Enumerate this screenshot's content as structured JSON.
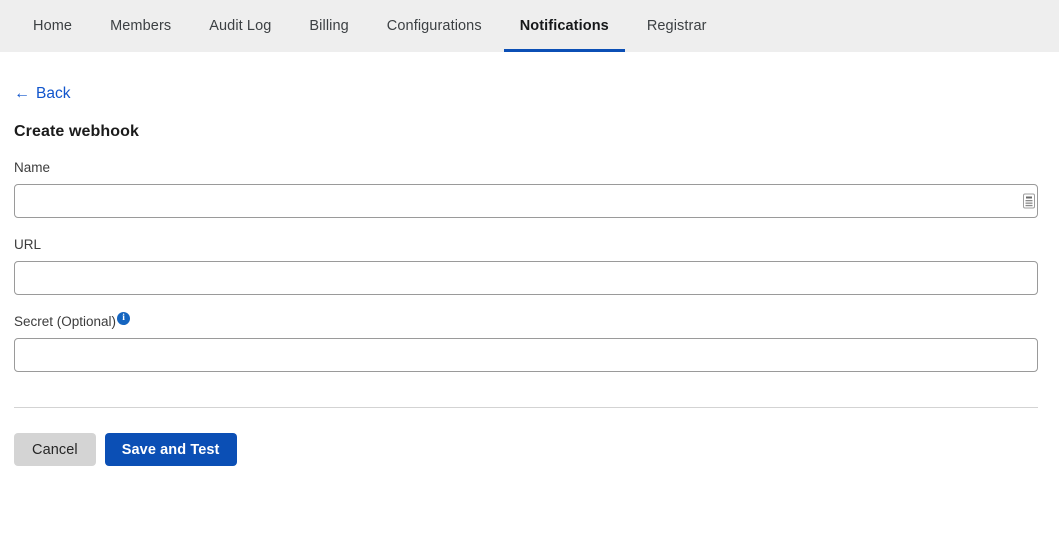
{
  "nav": {
    "tabs": [
      {
        "label": "Home",
        "active": false
      },
      {
        "label": "Members",
        "active": false
      },
      {
        "label": "Audit Log",
        "active": false
      },
      {
        "label": "Billing",
        "active": false
      },
      {
        "label": "Configurations",
        "active": false
      },
      {
        "label": "Notifications",
        "active": true
      },
      {
        "label": "Registrar",
        "active": false
      }
    ]
  },
  "back": {
    "arrow": "←",
    "label": "Back"
  },
  "page": {
    "title": "Create webhook"
  },
  "form": {
    "name": {
      "label": "Name",
      "value": "",
      "placeholder": "",
      "affordance_icon": "form-autofill-icon"
    },
    "url": {
      "label": "URL",
      "value": "",
      "placeholder": ""
    },
    "secret": {
      "label": "Secret (Optional)",
      "info_icon": "i",
      "value": "",
      "placeholder": ""
    }
  },
  "actions": {
    "cancel_label": "Cancel",
    "save_label": "Save and Test"
  },
  "colors": {
    "accent_blue": "#0b4fb5",
    "link_blue": "#1155cc",
    "info_blue": "#1565c0",
    "nav_background": "#eeeeee",
    "cancel_gray": "#d4d4d4",
    "divider_gray": "#d3d3d3"
  }
}
